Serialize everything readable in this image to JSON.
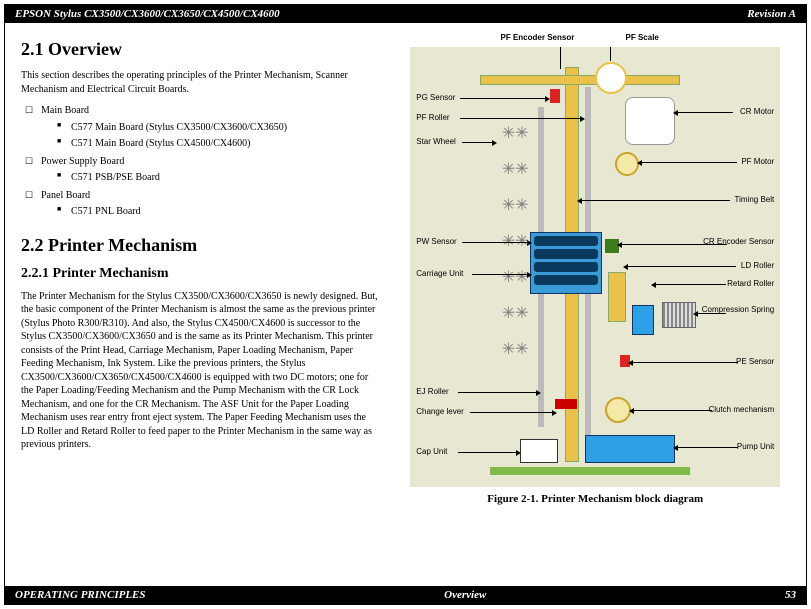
{
  "header": {
    "title": "EPSON Stylus CX3500/CX3600/CX3650/CX4500/CX4600",
    "rev": "Revision A"
  },
  "footer": {
    "left": "OPERATING PRINCIPLES",
    "center": "Overview",
    "page": "53"
  },
  "sec21": {
    "num_title": "2.1  Overview",
    "intro": "This section describes the operating principles of the Printer Mechanism, Scanner Mechanism and Electrical Circuit Boards.",
    "items": [
      {
        "label": "Main Board",
        "sub": [
          "C577 Main Board (Stylus CX3500/CX3600/CX3650)",
          "C571 Main Board (Stylus CX4500/CX4600)"
        ]
      },
      {
        "label": "Power Supply Board",
        "sub": [
          "C571 PSB/PSE Board"
        ]
      },
      {
        "label": "Panel Board",
        "sub": [
          "C571 PNL Board"
        ]
      }
    ]
  },
  "sec22": {
    "num_title": "2.2  Printer Mechanism",
    "sub_title": "2.2.1  Printer Mechanism",
    "body": "The Printer Mechanism for the Stylus CX3500/CX3600/CX3650 is newly designed. But, the basic component of the Printer Mechanism is almost the same as the previous printer (Stylus Photo R300/R310). And also, the Stylus CX4500/CX4600 is successor to the Stylus CX3500/CX3600/CX3650 and is the same as its Printer Mechanism. This printer consists of the Print Head, Carriage Mechanism, Paper Loading Mechanism, Paper Feeding Mechanism, Ink System. Like the previous printers, the Stylus CX3500/CX3600/CX3650/CX4500/CX4600 is equipped with two DC motors; one for the Paper Loading/Feeding Mechanism and the Pump Mechanism with the CR Lock Mechanism, and one for the CR Mechanism. The ASF Unit for the Paper Loading Mechanism uses rear entry front eject system. The Paper Feeding Mechanism uses the LD Roller and Retard Roller to feed paper to the Printer Mechanism in the same way as previous printers."
  },
  "figure": {
    "caption": "Figure 2-1.  Printer Mechanism block diagram",
    "labels": {
      "top1": "PF Encoder Sensor",
      "top2": "PF Scale",
      "l1": "PG Sensor",
      "l2": "PF Roller",
      "l3": "Star Wheel",
      "l4": "PW Sensor",
      "l5": "Carriage Unit",
      "l6": "EJ Roller",
      "l7": "Change lever",
      "l8": "Cap Unit",
      "r1": "CR Motor",
      "r2": "PF Motor",
      "r3": "Timing Belt",
      "r4": "CR Encoder Sensor",
      "r5": "LD Roller",
      "r6": "Retard Roller",
      "r7": "Compression Spring",
      "r8": "PE Sensor",
      "r9": "Clutch mechanism",
      "r10": "Pump Unit"
    }
  }
}
